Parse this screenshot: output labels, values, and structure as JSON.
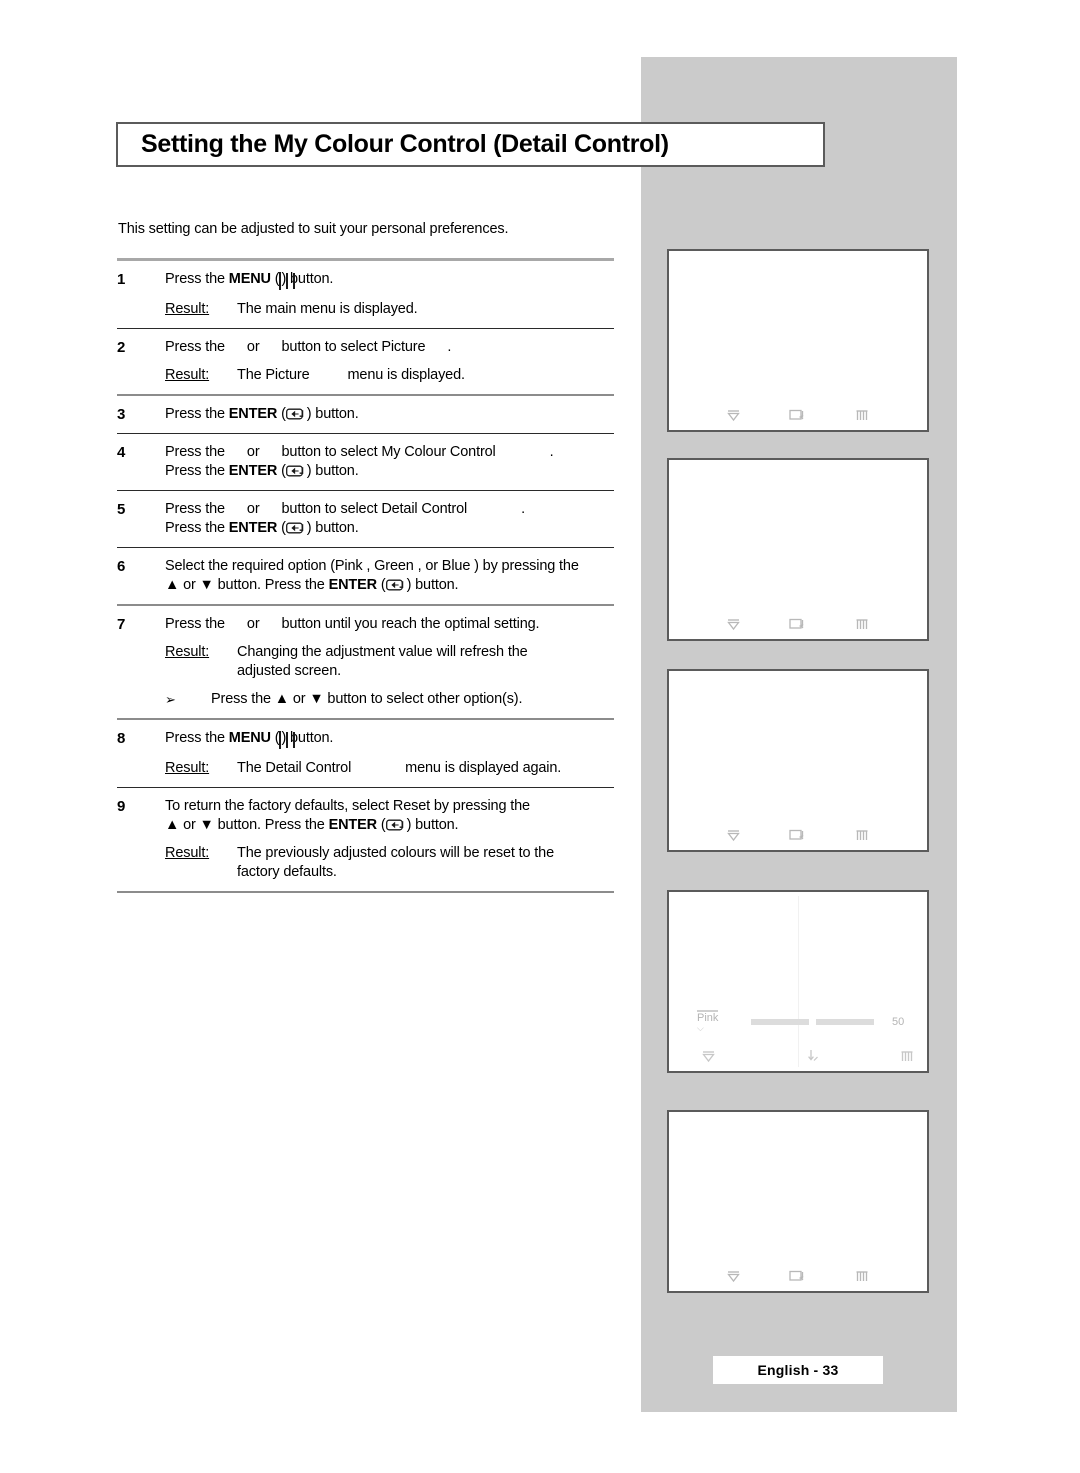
{
  "page": {
    "title": "Setting the My Colour Control (Detail Control)",
    "intro": "This setting can be adjusted to suit your personal preferences.",
    "footer": "English - 33"
  },
  "labels": {
    "result": "Result:",
    "press_the": "Press the",
    "or": "or",
    "button_label": "button.",
    "menu_key": "MENU",
    "enter_key": "ENTER"
  },
  "steps": [
    {
      "num": "1",
      "pre": "Press the ",
      "key": "MENU",
      "post": ") button.",
      "icon": "menu-icon",
      "result_label": "Result:",
      "result": "The main menu is displayed."
    },
    {
      "num": "2",
      "line": "Press the          or          button to select Picture        .",
      "text_a": "Press the",
      "text_b": "or",
      "text_c": "button to select Picture",
      "text_d": ".",
      "result_label": "Result:",
      "result_a": "The Picture",
      "result_b": "menu is displayed."
    },
    {
      "num": "3",
      "pre": "Press the ",
      "key": "ENTER",
      "post": ") button.",
      "icon": "enter-icon"
    },
    {
      "num": "4",
      "text_a": "Press the",
      "text_b": "or",
      "text_c": "button to select My Colour Control",
      "text_d": ".",
      "line2_pre": "Press the ",
      "line2_key": "ENTER",
      "line2_post": ") button."
    },
    {
      "num": "5",
      "text_a": "Press the",
      "text_b": "or",
      "text_c": "button to select Detail Control",
      "text_d": ".",
      "line2_pre": "Press the ",
      "line2_key": "ENTER",
      "line2_post": ") button."
    },
    {
      "num": "6",
      "text_a": "Select the required option (Pink  , Green , or Blue  ) by pressing the",
      "line2_a": "▲ or ▼ button. Press the ",
      "line2_key": "ENTER",
      "line2_post": ") button."
    },
    {
      "num": "7",
      "text_a": "Press the",
      "text_b": "or",
      "text_c": "button until you reach the optimal setting.",
      "result_label": "Result:",
      "result_line1": "Changing the adjustment value will refresh the",
      "result_line2": "adjusted screen.",
      "note_arrow": "➢",
      "note": "Press the ▲ or ▼ button to select other option(s)."
    },
    {
      "num": "8",
      "pre": "Press the ",
      "key": "MENU",
      "post": ") button.",
      "icon": "menu-icon",
      "result_label": "Result:",
      "result_a": "The Detail Control",
      "result_b": "menu is displayed again."
    },
    {
      "num": "9",
      "text_a": "To return the factory defaults, select Reset  by pressing the",
      "line2_a": "▲ or ▼ button. Press the ",
      "line2_key": "ENTER",
      "line2_post": ") button.",
      "result_label": "Result:",
      "result_line1": "The previously adjusted colours will be reset to the",
      "result_line2": "factory defaults."
    }
  ],
  "osd_panels": [
    {
      "name": "panel-1",
      "icons": [
        "move-down-icon",
        "enter-icon",
        "return-menu-icon"
      ]
    },
    {
      "name": "panel-2",
      "icons": [
        "move-down-icon",
        "enter-icon",
        "return-menu-icon"
      ]
    },
    {
      "name": "panel-3",
      "icons": [
        "move-down-icon",
        "enter-icon",
        "return-menu-icon"
      ]
    },
    {
      "name": "panel-4",
      "slider_label": "Pink",
      "slider_value": "50",
      "icons": [
        "move-down-icon",
        "adjust-icon",
        "return-menu-icon"
      ]
    },
    {
      "name": "panel-5",
      "icons": [
        "move-down-icon",
        "enter-icon",
        "return-menu-icon"
      ]
    }
  ],
  "colors": {
    "sidebar_grey": "#cbcbcb",
    "box_border": "#5b5b5b",
    "rule_grey": "#a8a8a8",
    "osd_text": "#b4b4b4"
  }
}
